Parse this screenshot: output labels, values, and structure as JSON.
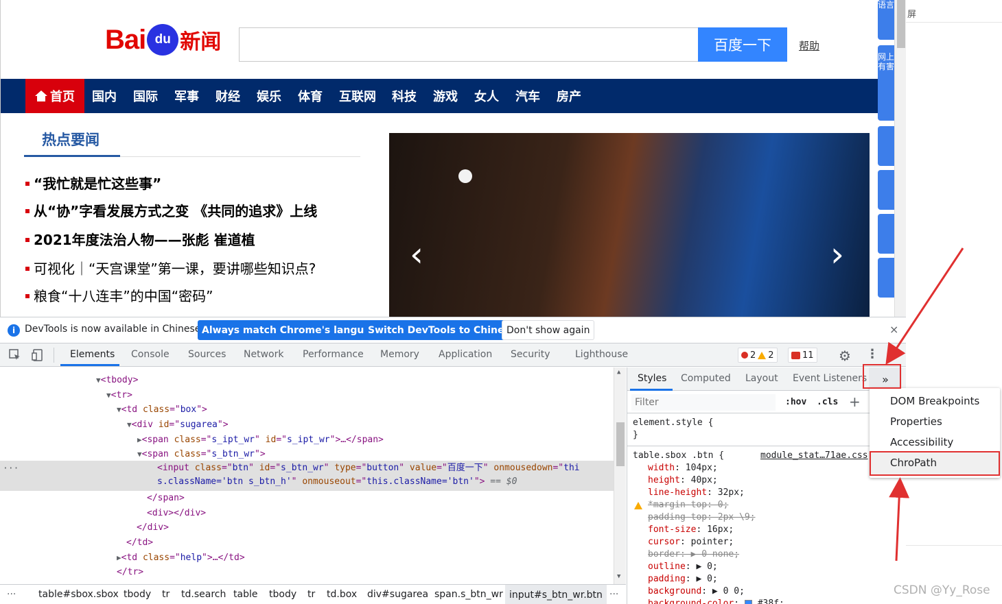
{
  "webpage": {
    "logo": {
      "part1": "Bai",
      "paw": "du",
      "part2": "新闻"
    },
    "search_button": "百度一下",
    "help_link": "帮助",
    "nav": {
      "home": "首页",
      "items": [
        "国内",
        "国际",
        "军事",
        "财经",
        "娱乐",
        "体育",
        "互联网",
        "科技",
        "游戏",
        "女人",
        "汽车",
        "房产"
      ]
    },
    "hot_title": "热点要闻",
    "news": [
      "“我忙就是忙这些事”",
      "从“协”字看发展方式之变 《共同的追求》上线",
      "2021年度法治人物——张彪 崔道植",
      "可视化｜“天宫课堂”第一课，要讲哪些知识点?",
      "粮食“十八连丰”的中国“密码”"
    ],
    "carousel": {
      "prev": "‹",
      "next": "›"
    },
    "right_strip": [
      "语言",
      "网上有害",
      "",
      "",
      "",
      ""
    ],
    "outer_text": "屏"
  },
  "devtools": {
    "infobar": {
      "text": "DevTools is now available in Chinese!",
      "btn_match": "Always match Chrome's language",
      "btn_switch": "Switch DevTools to Chinese",
      "btn_dont": "Don't show again",
      "close": "×"
    },
    "tabs": [
      "Elements",
      "Console",
      "Sources",
      "Network",
      "Performance",
      "Memory",
      "Application",
      "Security",
      "Lighthouse"
    ],
    "badges": {
      "errors": "2",
      "warnings": "2",
      "issues": "11"
    },
    "elements": {
      "lines": [
        {
          "indent": 140,
          "tri": "▼",
          "tag": "tbody"
        },
        {
          "indent": 155,
          "tri": "▼",
          "tag": "tr"
        },
        {
          "indent": 170,
          "tri": "▼",
          "tag": "td",
          "attr": "class",
          "val": "box"
        },
        {
          "indent": 185,
          "tri": "▼",
          "tag": "div",
          "attr": "id",
          "val": "sugarea"
        },
        {
          "indent": 200,
          "tri": "▶",
          "tag": "span",
          "attr": "class",
          "val": "s_ipt_wr",
          "attr2": "id",
          "val2": "s_ipt_wr",
          "tail": ">…</span>"
        },
        {
          "indent": 200,
          "tri": "▼",
          "tag": "span",
          "attr": "class",
          "val": "s_btn_wr"
        }
      ],
      "input_line1": {
        "tag": "input",
        "class": "btn",
        "id": "s_btn_wr",
        "type": "button",
        "value": "百度一下",
        "onmousedown": "thi"
      },
      "input_line2": {
        "cont": "s.className='btn s_btn_h'",
        "onmouseout": "this.className='btn'",
        "dollar": "== $0"
      },
      "closing": [
        "</span>",
        "<div></div>",
        "</div>",
        "</td>"
      ],
      "help_td": {
        "tag": "td",
        "attr": "class",
        "val": "help",
        "tail": ">…</td>"
      },
      "tr_close": "</tr>"
    },
    "breadcrumbs": [
      "table#sbox.sbox",
      "tbody",
      "tr",
      "td.search",
      "table",
      "tbody",
      "tr",
      "td.box",
      "div#sugarea",
      "span.s_btn_wr",
      "input#s_btn_wr.btn"
    ],
    "styles": {
      "subtabs": [
        "Styles",
        "Computed",
        "Layout",
        "Event Listeners"
      ],
      "more": "»",
      "filter_placeholder": "Filter",
      "hov": ":hov",
      "cls": ".cls",
      "plus": "+",
      "element_style": "element.style {",
      "close_brace": "}",
      "rule_selector": "table.sbox .btn {",
      "rule_source": "module_stat…71ae.css",
      "props": [
        {
          "name": "width",
          "value": "104px;",
          "strike": false
        },
        {
          "name": "height",
          "value": "40px;",
          "strike": false
        },
        {
          "name": "line-height",
          "value": "32px;",
          "strike": false
        },
        {
          "name": "*margin-top",
          "value": "0;",
          "strike": true,
          "warn": true
        },
        {
          "name": "padding-top",
          "value": "2px \\9;",
          "strike": true
        },
        {
          "name": "font-size",
          "value": "16px;",
          "strike": false
        },
        {
          "name": "cursor",
          "value": "pointer;",
          "strike": false
        },
        {
          "name": "border",
          "value": "▶ 0 none;",
          "strike": true
        },
        {
          "name": "outline",
          "value": "▶ 0;",
          "strike": false
        },
        {
          "name": "padding",
          "value": "▶ 0;",
          "strike": false
        },
        {
          "name": "background",
          "value": "▶ 0 0;",
          "strike": false
        },
        {
          "name": "background-color",
          "value": "#38f;",
          "strike": false
        }
      ]
    },
    "menu": [
      "DOM Breakpoints",
      "Properties",
      "Accessibility",
      "ChroPath"
    ]
  },
  "watermark": "CSDN @Yy_Rose",
  "colors": {
    "accent": "#1a73e8",
    "baidu_red": "#e10601",
    "baidu_blue": "#3385ff",
    "nav_bg": "#012a6b",
    "annotation_red": "#e03030"
  }
}
